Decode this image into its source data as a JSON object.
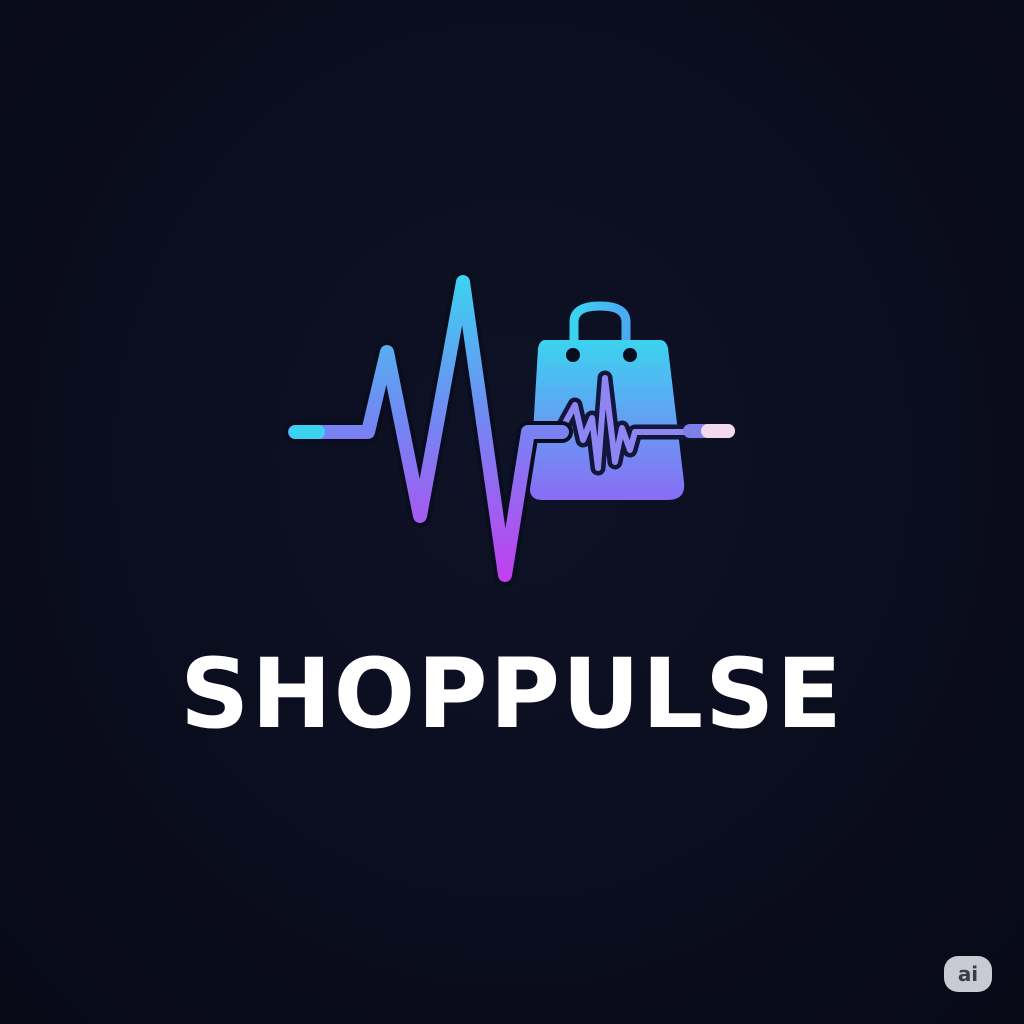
{
  "brand": {
    "name": "SHOPPULSE",
    "badge": "ai",
    "icons": {
      "mark": "pulse-line-icon",
      "bag": "shopping-bag-icon"
    },
    "colors": {
      "background": "#0a0d1d",
      "wordmark": "#ffffff",
      "cyan": "#3cd3f0",
      "violet": "#8a6cf5",
      "magenta": "#c13ff0",
      "pink_tip": "#f3d9ee",
      "badge_bg": "#c9cbd2",
      "badge_text": "#3a3d48"
    }
  }
}
